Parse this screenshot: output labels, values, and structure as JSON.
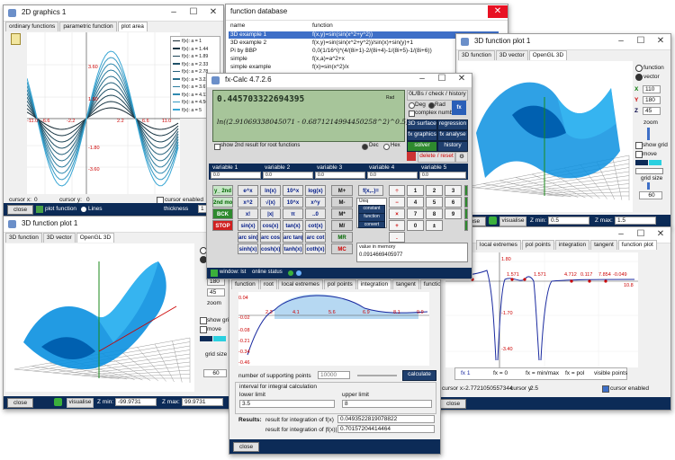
{
  "win_graphics": {
    "title": "2D graphics 1",
    "tabs": [
      "ordinary functions",
      "parametric function",
      "plot area"
    ],
    "y_ticks": [
      "3.60",
      "1.80",
      "-1.80",
      "-3.60"
    ],
    "x_ticks": [
      "-11.0",
      "-6.6",
      "-2.2",
      "2.2",
      "6.6",
      "11.0"
    ],
    "legend": [
      "f(x): a = 1",
      "f(x): a = 1.44",
      "f(x): a = 1.89",
      "f(x): a = 2.33",
      "f(x): a = 2.78",
      "f(x): a = 3.22",
      "f(x): a = 3.67",
      "f(x): a = 4.11",
      "f(x): a = 4.56",
      "f(x): a = 5"
    ],
    "cursor_x_label": "cursor x:",
    "cursor_x_value": "0",
    "cursor_y_label": "cursor y:",
    "cursor_y_value": "0",
    "cursor_enabled": "cursor enabled",
    "close": "close",
    "plot_function": "plot function",
    "lines": "Lines",
    "thickness_label": "thickness",
    "thickness_value": "1"
  },
  "win_db": {
    "title": "function database",
    "col_name": "name",
    "col_function": "function",
    "rows": [
      {
        "name": "3D example 1",
        "function": "f(x,y)=sin(sin(x^2+y^2))"
      },
      {
        "name": "3D example 2",
        "function": "f(x,y)=sin(sin(x^2+y^2))/sin(x)+sin(y)+1"
      },
      {
        "name": "Pi by BBP",
        "function": "0,0(1/16^i)*(4/(8i+1)-2/(8i+4)-1/(8i+5)-1/(8i+6))"
      },
      {
        "name": "simple",
        "function": "f(x,a)=a^2+x"
      },
      {
        "name": "simple example",
        "function": "f(x)=sin(x^2)/x"
      }
    ]
  },
  "win_3d1": {
    "title": "3D function plot 1",
    "tabs": [
      "3D function",
      "3D vector",
      "OpenGL 3D"
    ],
    "radio_function": "function",
    "radio_vector": "vector",
    "x_label": "X",
    "x_value": "110",
    "y_label": "Y",
    "y_value": "180",
    "z_label": "Z",
    "z_value": "45",
    "zoom": "zoom",
    "show_grid": "show grid",
    "move": "move",
    "grid_size": "grid size",
    "grid_size_value": "60",
    "close": "close",
    "visualise": "visualise",
    "z_min_label": "Z min:",
    "z_min_value": "0.5",
    "z_max_label": "Z max:",
    "z_max_value": "1.5"
  },
  "win_calc": {
    "title": "fx-Calc 4.7.2.6",
    "result": "0.445703322694395",
    "rad_label": "Rad",
    "expression": "ln((2.91069338045071 - 0.6871214994450258^2)^0.5)",
    "show2nd": "show 2nd result for root functions",
    "dec": "Dec",
    "hex": "Hex",
    "btn_mode": "0L/Bs / check / history",
    "deg": "Deg",
    "rad": "Rad",
    "complex_numbers": "complex numbers",
    "sd_surface": "3D surface",
    "regression": "regression",
    "fx_graphics": "fx graphics",
    "fx_analyse": "fx analyse",
    "solver": "solver",
    "history": "history",
    "delete_reset": "delete / reset",
    "variables": [
      "variable 1",
      "variable 2",
      "variable 3",
      "variable 4",
      "variable 5"
    ],
    "var_values": [
      "0.0",
      "0.0",
      "0.0",
      "0.0",
      "0.0"
    ],
    "btn_cmds": [
      "y_ 2nd",
      "2nd mode",
      "BCK",
      "STOP"
    ],
    "keys_fn": [
      [
        "e^x",
        "ln(x)",
        "10^x",
        "log(x)"
      ],
      [
        "x^2",
        "√(x)",
        "10^x",
        "x^y"
      ],
      [
        "x!",
        "|x|",
        "π",
        "..0"
      ],
      [
        "sin(x)",
        "cos(x)",
        "tan(x)",
        "cot(x)"
      ],
      [
        "arc sin(x)",
        "arc cos(x)",
        "arc tan(x)",
        "arc cot"
      ],
      [
        "sinh(x)",
        "cosh(x)",
        "tanh(x)",
        "coth(x)"
      ]
    ],
    "mem_keys": [
      "M+",
      "M-",
      "M*",
      "M/",
      "MR",
      "MC"
    ],
    "special": [
      "f(x,..)=",
      "Uniq",
      "constant",
      "function",
      "convert"
    ],
    "num_ops": [
      "÷",
      "−",
      "×",
      "+",
      "."
    ],
    "numbers": [
      "1",
      "2",
      "3",
      "4",
      "5",
      "6",
      "7",
      "8",
      "9",
      "0",
      "±"
    ],
    "sub_labels": [
      "Deg",
      "Rad"
    ],
    "mem_title": "value in memory",
    "mem_value": "0.0914669405977",
    "status_left": "window: lst",
    "status_mid": "online status"
  },
  "win_3d2": {
    "title": "3D function plot 1",
    "tabs": [
      "3D function",
      "3D vector",
      "OpenGL 3D"
    ],
    "x_value": "110",
    "y_value": "180",
    "z_value": "45",
    "zoom": "zoom",
    "show_grid": "show grid",
    "move": "move",
    "grid_size": "grid size",
    "grid_size_value": "60",
    "close": "close",
    "visualise": "visualise",
    "z_min_label": "Z min:",
    "z_min_value": "-99.9731",
    "z_max_label": "Z max:",
    "z_max_value": "99.9731"
  },
  "win_integ": {
    "tabs": [
      "function",
      "root",
      "local extremes",
      "pol points",
      "integration",
      "tangent",
      "function plot"
    ],
    "y_ticks": [
      "0.04",
      "-0.02",
      "-0.08",
      "-0.21",
      "-0.34",
      "-0.46"
    ],
    "x_ticks": [
      "2.3",
      "4.1",
      "5.6",
      "6.9",
      "8.1",
      "9.9"
    ],
    "supporting_label": "number of supporting points",
    "supporting_value": "10000",
    "calculate": "calculate",
    "interval_title": "interval for integral calculation",
    "lower": "lower limit",
    "lower_value": "3.5",
    "upper": "upper limit",
    "upper_value": "8",
    "results": "Results:",
    "res1_label": "result for integration of f(x)",
    "res1_value": "0.0493522819078822",
    "res2_label": "result for integration of |f(x)|",
    "res2_value": "0.70157204414464",
    "close": "close"
  },
  "win_analyse": {
    "tabs": [
      "local extremes",
      "pol points",
      "integration",
      "tangent",
      "function plot"
    ],
    "y_ticks": [
      "1.80",
      "-1.70",
      "-3.40"
    ],
    "x_ticks": [
      "1.571",
      "1.571",
      "4.712",
      "0.117",
      "7.854",
      "-0.049",
      "10.8"
    ],
    "legend": [
      "fx 1",
      "fx = 0",
      "fx = min/max",
      "fx = pol",
      "visible points"
    ],
    "cursor_x_label": "cursor x:",
    "cursor_x_value": "-2.7721050557344",
    "cursor_y_label": "cursor y:",
    "cursor_y_value": "2.5",
    "cursor_enabled": "cursor enabled",
    "close": "close"
  },
  "colors": {
    "title_blue": "#0c2b57",
    "lcd": "#a7c59a",
    "surface_blue": "#0a90e0"
  }
}
